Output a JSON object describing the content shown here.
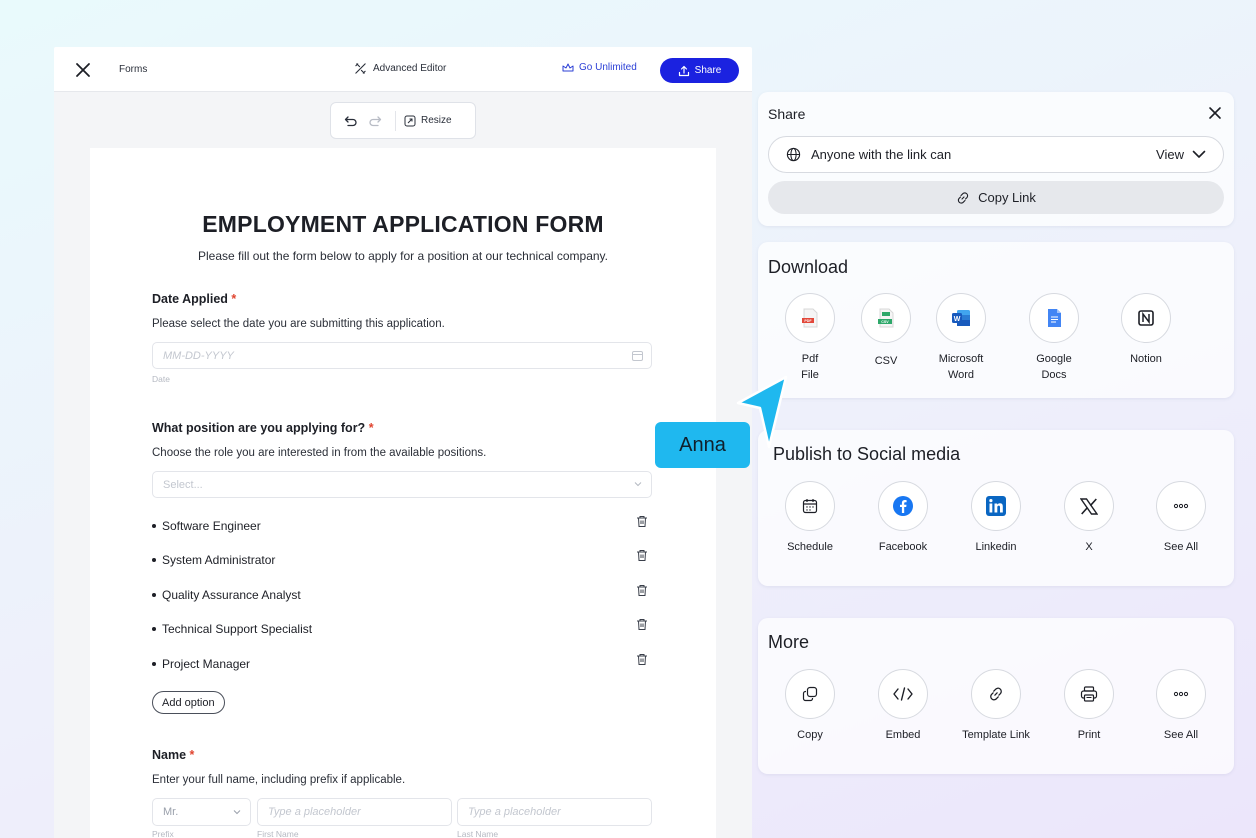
{
  "topbar": {
    "forms_label": "Forms",
    "advanced_editor_label": "Advanced Editor",
    "go_unlimited_label": "Go Unlimited",
    "share_label": "Share"
  },
  "toolbar": {
    "resize_label": "Resize"
  },
  "form": {
    "title": "EMPLOYMENT APPLICATION FORM",
    "description": "Please fill out the form below to apply for a position at our technical company.",
    "date_question": {
      "label": "Date Applied",
      "required_mark": "*",
      "help": "Please select the date you are submitting this application.",
      "placeholder": "MM-DD-YYYY",
      "sublabel": "Date"
    },
    "position_question": {
      "label": "What position are you applying for?",
      "required_mark": "*",
      "help": "Choose the role you are interested in from the available positions.",
      "placeholder": "Select...",
      "options": [
        "Software Engineer",
        "System Administrator",
        "Quality Assurance Analyst",
        "Technical Support Specialist",
        "Project Manager"
      ],
      "add_option_label": "Add option"
    },
    "name_question": {
      "label": "Name",
      "required_mark": "*",
      "help": "Enter your full name, including prefix if applicable.",
      "prefix_value": "Mr.",
      "first_placeholder": "Type a placeholder",
      "last_placeholder": "Type a placeholder",
      "prefix_sublabel": "Prefix",
      "first_sublabel": "First Name",
      "last_sublabel": "Last Name"
    }
  },
  "share_panel": {
    "title": "Share",
    "access_text": "Anyone with the link can",
    "access_value": "View",
    "copy_link_label": "Copy Link"
  },
  "download_panel": {
    "title": "Download",
    "items": [
      {
        "label": "Pdf\nFile",
        "icon": "pdf-icon"
      },
      {
        "label": "CSV",
        "icon": "csv-icon"
      },
      {
        "label": "Microsoft\nWord",
        "icon": "word-icon"
      },
      {
        "label": "Google\nDocs",
        "icon": "google-docs-icon"
      },
      {
        "label": "Notion",
        "icon": "notion-icon"
      }
    ]
  },
  "social_panel": {
    "title": "Publish to Social media",
    "items": [
      {
        "label": "Schedule",
        "icon": "calendar-icon"
      },
      {
        "label": "Facebook",
        "icon": "facebook-icon"
      },
      {
        "label": "Linkedin",
        "icon": "linkedin-icon"
      },
      {
        "label": "X",
        "icon": "x-icon"
      },
      {
        "label": "See All",
        "icon": "more-icon"
      }
    ]
  },
  "more_panel": {
    "title": "More",
    "items": [
      {
        "label": "Copy",
        "icon": "copy-icon"
      },
      {
        "label": "Embed",
        "icon": "code-icon"
      },
      {
        "label": "Template Link",
        "icon": "link-icon"
      },
      {
        "label": "Print",
        "icon": "printer-icon"
      },
      {
        "label": "See All",
        "icon": "more-icon"
      }
    ]
  },
  "collaborator": {
    "name": "Anna"
  },
  "colors": {
    "primary": "#1b22e0",
    "accent_link": "#2b3fd6",
    "required": "#e0442f",
    "collaborator": "#1fb8ef"
  }
}
